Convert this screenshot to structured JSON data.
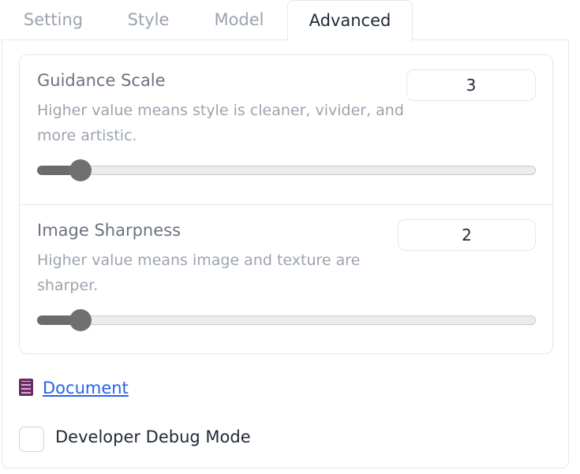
{
  "tabs": [
    {
      "label": "Setting",
      "active": false
    },
    {
      "label": "Style",
      "active": false
    },
    {
      "label": "Model",
      "active": false
    },
    {
      "label": "Advanced",
      "active": true
    }
  ],
  "sliders": [
    {
      "label": "Guidance Scale",
      "info_line1": "Higher value means style is cleaner, vivider, and",
      "info_line2": "more artistic.",
      "value": "3",
      "level": 0.085
    },
    {
      "label": "Image Sharpness",
      "info_line1": "Higher value means image and texture are",
      "info_line2": "sharper.",
      "value": "2",
      "level": 0.085
    }
  ],
  "document_link": {
    "label": "Document",
    "icon": "book-icon"
  },
  "debug": {
    "label": "Developer Debug Mode",
    "checked": false
  },
  "colors": {
    "link": "#2563eb",
    "slider_fill": "#6b6b6b",
    "slider_track": "#ececec",
    "border": "#e5e7eb"
  }
}
